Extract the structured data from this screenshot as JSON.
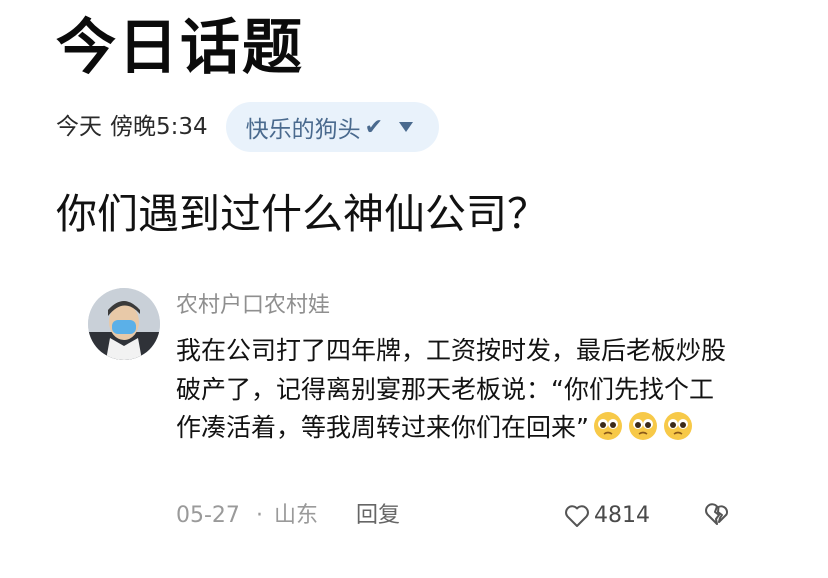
{
  "header": {
    "title": "今日话题"
  },
  "meta": {
    "date": "今天",
    "time": "傍晚5:34",
    "author": "快乐的狗头",
    "verified_icon": "check-icon",
    "dropdown_icon": "chevron-down-icon"
  },
  "question": "你们遇到过什么神仙公司？",
  "comment": {
    "username": "农村户口农村娃",
    "content": "我在公司打了四年牌，工资按时发，最后老板炒股破产了，记得离别宴那天老板说：“你们先找个工作凑活着，等我周转过来你们在回来”",
    "emoji": [
      "pleading-face-emoji",
      "pleading-face-emoji",
      "pleading-face-emoji"
    ],
    "date": "05-27",
    "separator": "·",
    "location": "山东",
    "reply_label": "回复",
    "likes": "4814",
    "like_icon": "heart-icon",
    "dislike_icon": "broken-heart-icon"
  },
  "colors": {
    "accent": "#4a6a8e",
    "pill_bg": "#e9f2fb",
    "muted": "#9a9a9a"
  }
}
